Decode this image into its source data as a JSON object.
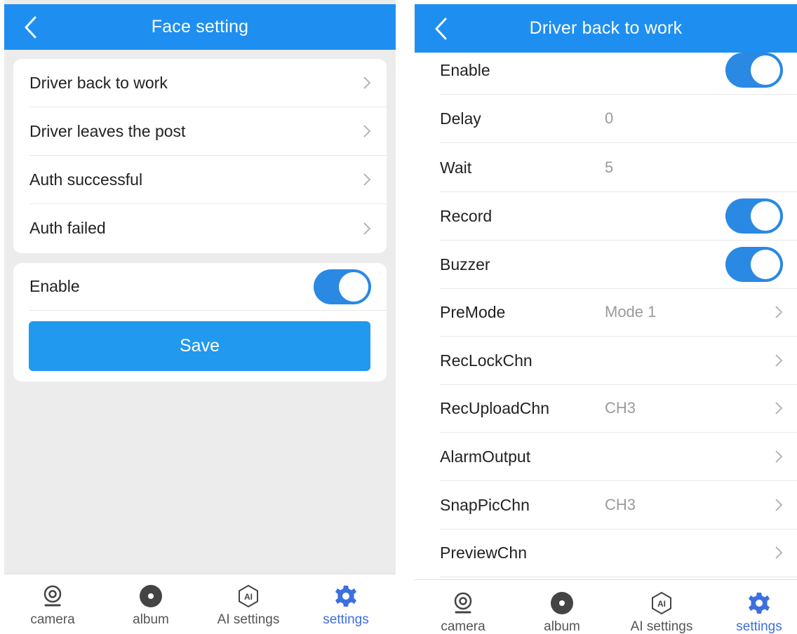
{
  "left_screen": {
    "header": {
      "title": "Face setting"
    },
    "menu": [
      {
        "label": "Driver back to work"
      },
      {
        "label": "Driver leaves the post"
      },
      {
        "label": "Auth successful"
      },
      {
        "label": "Auth failed"
      }
    ],
    "enable": {
      "label": "Enable",
      "on": true
    },
    "save_label": "Save"
  },
  "right_screen": {
    "header": {
      "title": "Driver back to work"
    },
    "rows": [
      {
        "label": "Enable",
        "toggle": true
      },
      {
        "label": "Delay",
        "value": "0"
      },
      {
        "label": "Wait",
        "value": "5"
      },
      {
        "label": "Record",
        "toggle": true
      },
      {
        "label": "Buzzer",
        "toggle": true
      },
      {
        "label": "PreMode",
        "value": "Mode 1"
      },
      {
        "label": "RecLockChn",
        "value": ""
      },
      {
        "label": "RecUploadChn",
        "value": "CH3"
      },
      {
        "label": "AlarmOutput",
        "value": ""
      },
      {
        "label": "SnapPicChn",
        "value": "CH3"
      },
      {
        "label": "PreviewChn",
        "value": ""
      }
    ]
  },
  "tabbar": {
    "tabs": [
      {
        "label": "camera",
        "icon": "camera-icon"
      },
      {
        "label": "album",
        "icon": "album-icon"
      },
      {
        "label": "AI settings",
        "icon": "ai-icon"
      },
      {
        "label": "settings",
        "icon": "gear-icon",
        "active": true
      }
    ]
  },
  "colors": {
    "header": "#1e8ff0",
    "toggle_on": "#2a89e3",
    "save_button": "#2099ef",
    "active_tab": "#3d6fe0",
    "page_bg": "#ececec"
  }
}
